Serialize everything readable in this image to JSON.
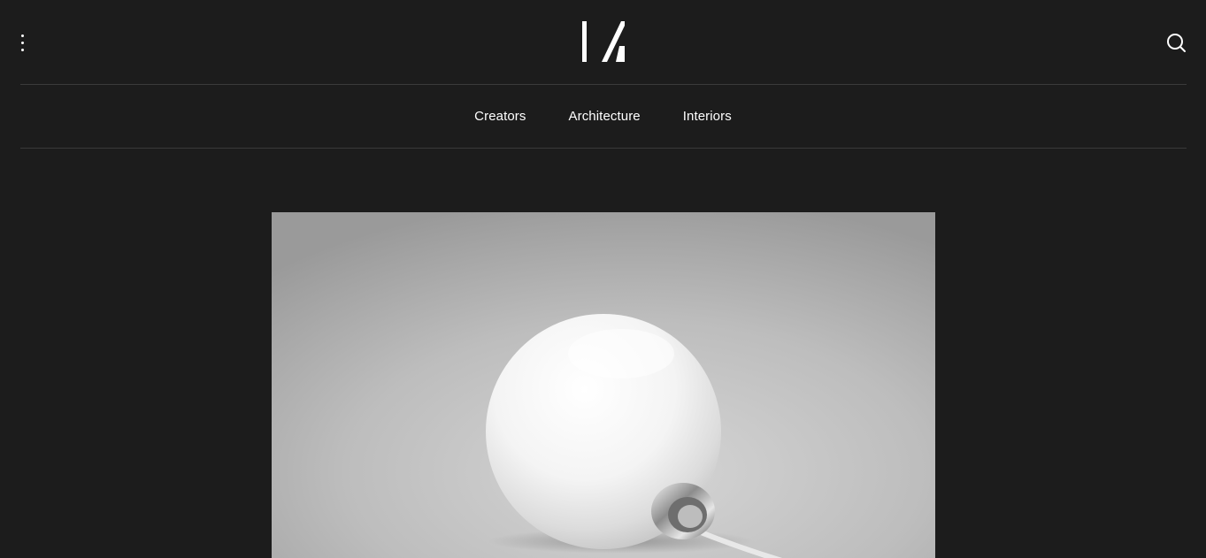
{
  "header": {
    "menu_icon": "vertical-dots-icon",
    "logo_icon": "brand-logo-mark",
    "search_icon": "search-icon"
  },
  "nav": {
    "items": [
      {
        "label": "Creators"
      },
      {
        "label": "Architecture"
      },
      {
        "label": "Interiors"
      }
    ]
  },
  "hero": {
    "image": "white-sphere-lamp-photo"
  },
  "colors": {
    "background": "#1c1c1c",
    "text": "#ffffff",
    "divider": "#3a3a3a"
  }
}
